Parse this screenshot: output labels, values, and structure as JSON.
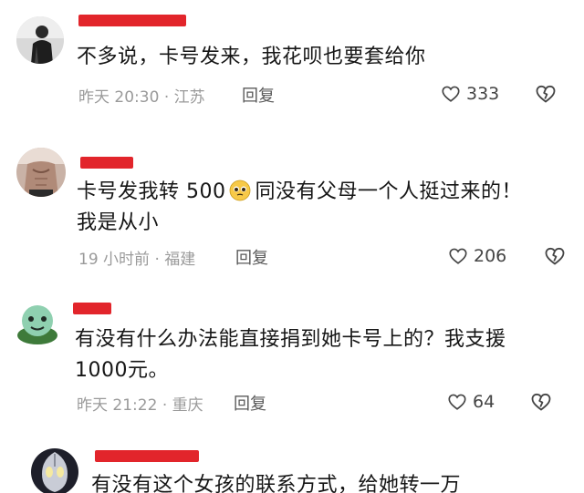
{
  "comments": [
    {
      "text_lines": [
        "不多说，卡号发来，我花呗也要套给你"
      ],
      "time": "昨天 20:30",
      "location": "江苏",
      "reply_label": "回复",
      "likes": "333",
      "avatar_icon": "person-avatar"
    },
    {
      "text_before_emoji": "卡号发我转 500",
      "emoji_icon": "pleading-face-emoji",
      "text_after_emoji": "同没有父母一个人挺过来的！",
      "text_line2": "我是从小",
      "time": "19 小时前",
      "location": "福建",
      "reply_label": "回复",
      "likes": "206",
      "avatar_icon": "torso-avatar"
    },
    {
      "text_lines": [
        "有没有什么办法能直接捐到她卡号上的？我支援",
        "1000元。"
      ],
      "time": "昨天 21:22",
      "location": "重庆",
      "reply_label": "回复",
      "likes": "64",
      "avatar_icon": "turtle-avatar"
    },
    {
      "text_lines": [
        "有没有这个女孩的联系方式，给她转一万"
      ],
      "avatar_icon": "ultraman-avatar"
    }
  ],
  "colors": {
    "redaction": "#e2252b",
    "meta_text": "#9a9a9a",
    "reply_text": "#5a5a5a"
  }
}
